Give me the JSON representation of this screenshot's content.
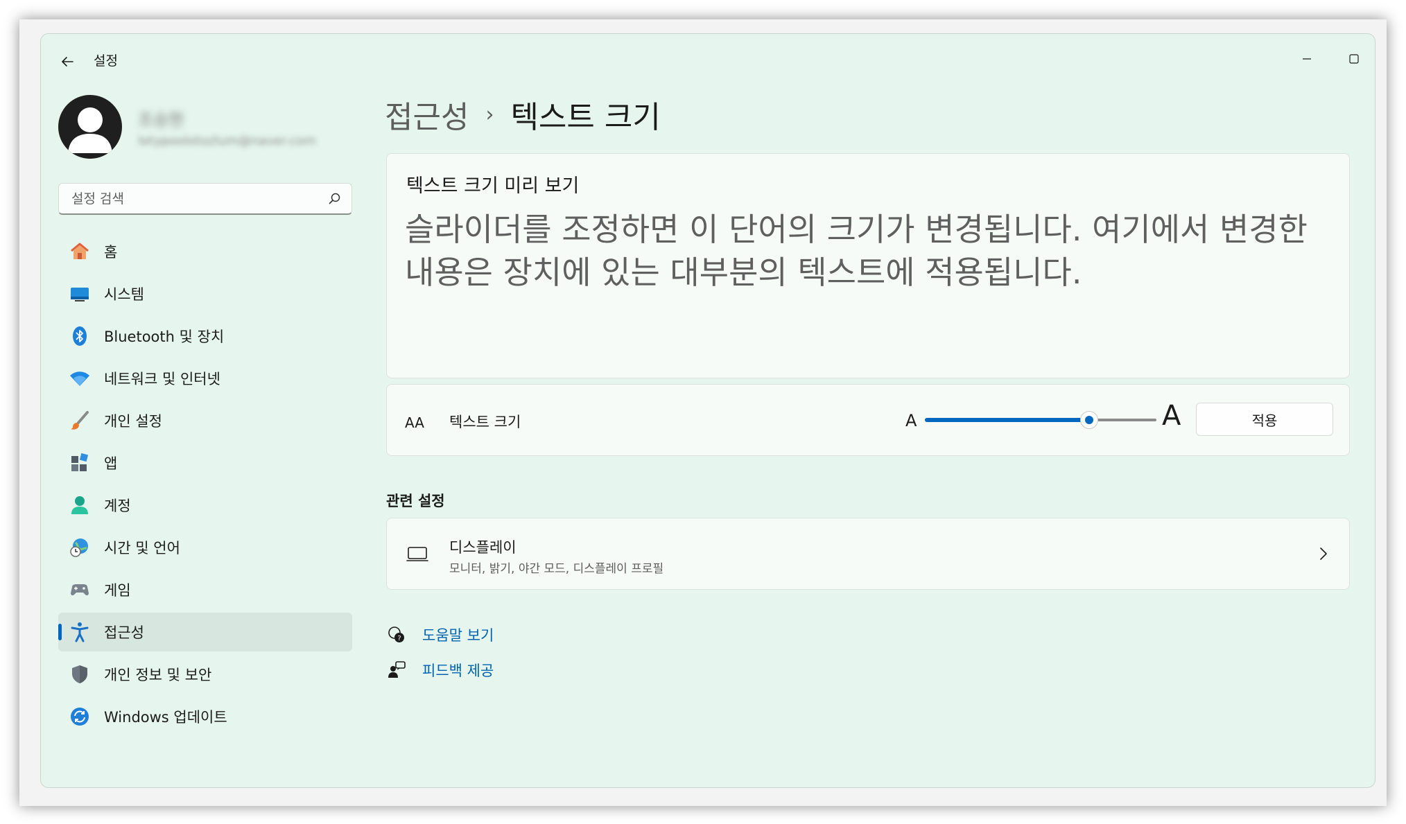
{
  "window": {
    "title": "설정",
    "minimize_icon": "minimize-icon",
    "maximize_icon": "maximize-icon",
    "close_icon": "close-icon"
  },
  "profile": {
    "name": "조승현",
    "email": "lotypoolotozlum@naver.com"
  },
  "search": {
    "placeholder": "설정 검색"
  },
  "sidebar": {
    "items": [
      {
        "label": "홈",
        "icon": "home-icon"
      },
      {
        "label": "시스템",
        "icon": "system-icon"
      },
      {
        "label": "Bluetooth 및 장치",
        "icon": "bluetooth-icon"
      },
      {
        "label": "네트워크 및 인터넷",
        "icon": "wifi-icon"
      },
      {
        "label": "개인 설정",
        "icon": "brush-icon"
      },
      {
        "label": "앱",
        "icon": "apps-icon"
      },
      {
        "label": "계정",
        "icon": "account-icon"
      },
      {
        "label": "시간 및 언어",
        "icon": "globe-clock-icon"
      },
      {
        "label": "게임",
        "icon": "gamepad-icon"
      },
      {
        "label": "접근성",
        "icon": "accessibility-icon",
        "active": true
      },
      {
        "label": "개인 정보 및 보안",
        "icon": "shield-icon"
      },
      {
        "label": "Windows 업데이트",
        "icon": "update-icon"
      }
    ]
  },
  "breadcrumb": {
    "parent": "접근성",
    "separator": "›",
    "current": "텍스트 크기"
  },
  "preview": {
    "title": "텍스트 크기 미리 보기",
    "text": "슬라이더를 조정하면 이 단어의 크기가 변경됩니다. 여기에서 변경한 내용은 장치에 있는 대부분의 텍스트에 적용됩니다."
  },
  "text_size": {
    "icon_glyph": "AA",
    "label": "텍스트 크기",
    "small_a": "A",
    "large_a": "A",
    "slider_fraction": 0.71,
    "apply_label": "적용"
  },
  "related": {
    "heading": "관련 설정",
    "display": {
      "title": "디스플레이",
      "subtitle": "모니터, 밝기, 야간 모드, 디스플레이 프로필"
    }
  },
  "links": {
    "help": "도움말 보기",
    "feedback": "피드백 제공"
  },
  "colors": {
    "accent": "#0067c0",
    "window_bg": "#e6f6ee",
    "card_bg": "#f6fbf8",
    "link": "#0063b1"
  }
}
